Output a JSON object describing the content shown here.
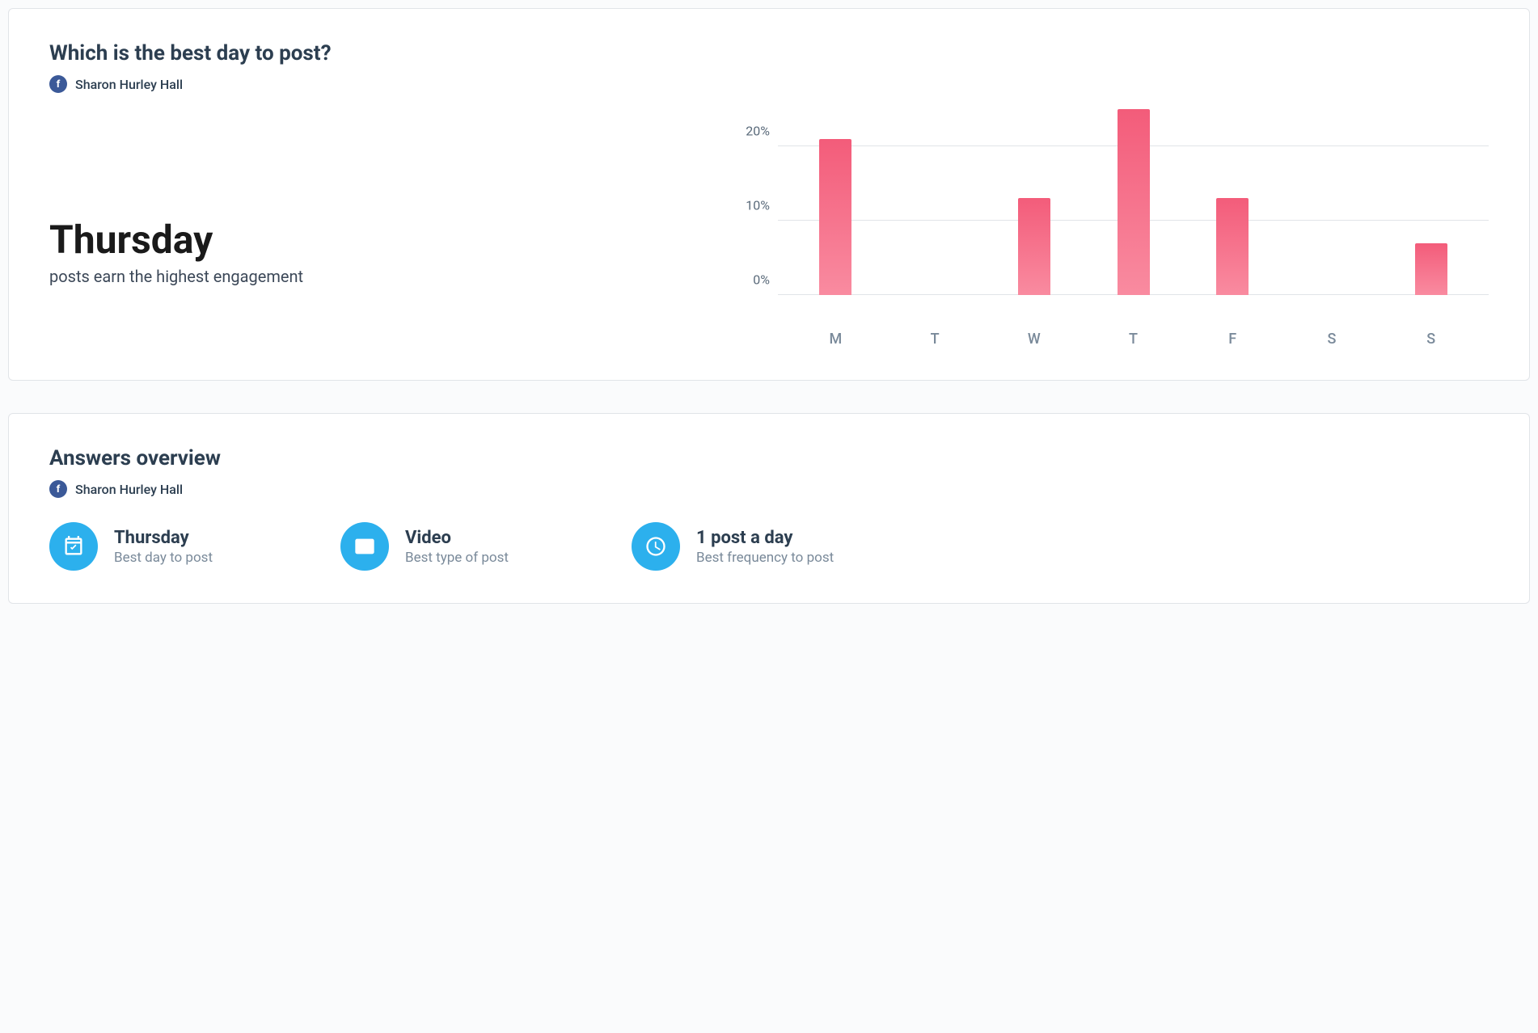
{
  "card1": {
    "title": "Which is the best day to post?",
    "author": "Sharon Hurley Hall",
    "highlight_value": "Thursday",
    "highlight_caption": "posts earn the highest engagement"
  },
  "card2": {
    "title": "Answers overview",
    "author": "Sharon Hurley Hall",
    "answers": [
      {
        "title": "Thursday",
        "sub": "Best day to post",
        "icon": "calendar-check-icon"
      },
      {
        "title": "Video",
        "sub": "Best type of post",
        "icon": "post-icon"
      },
      {
        "title": "1 post a day",
        "sub": "Best frequency to post",
        "icon": "clock-icon"
      }
    ]
  },
  "chart_data": {
    "type": "bar",
    "categories": [
      "M",
      "T",
      "W",
      "T",
      "F",
      "S",
      "S"
    ],
    "values": [
      21,
      0,
      13,
      25,
      13,
      0,
      7
    ],
    "title": "Which is the best day to post?",
    "xlabel": "",
    "ylabel": "",
    "ylim": [
      0,
      25
    ],
    "yticks": [
      0,
      10,
      20
    ],
    "ytick_labels": [
      "0%",
      "10%",
      "20%"
    ],
    "bar_color_top": "#f35c7a",
    "bar_color_bottom": "#f98ba0"
  },
  "colors": {
    "accent": "#2cb0ed",
    "facebook": "#3b5998",
    "bar_pink": "#f35c7a"
  }
}
